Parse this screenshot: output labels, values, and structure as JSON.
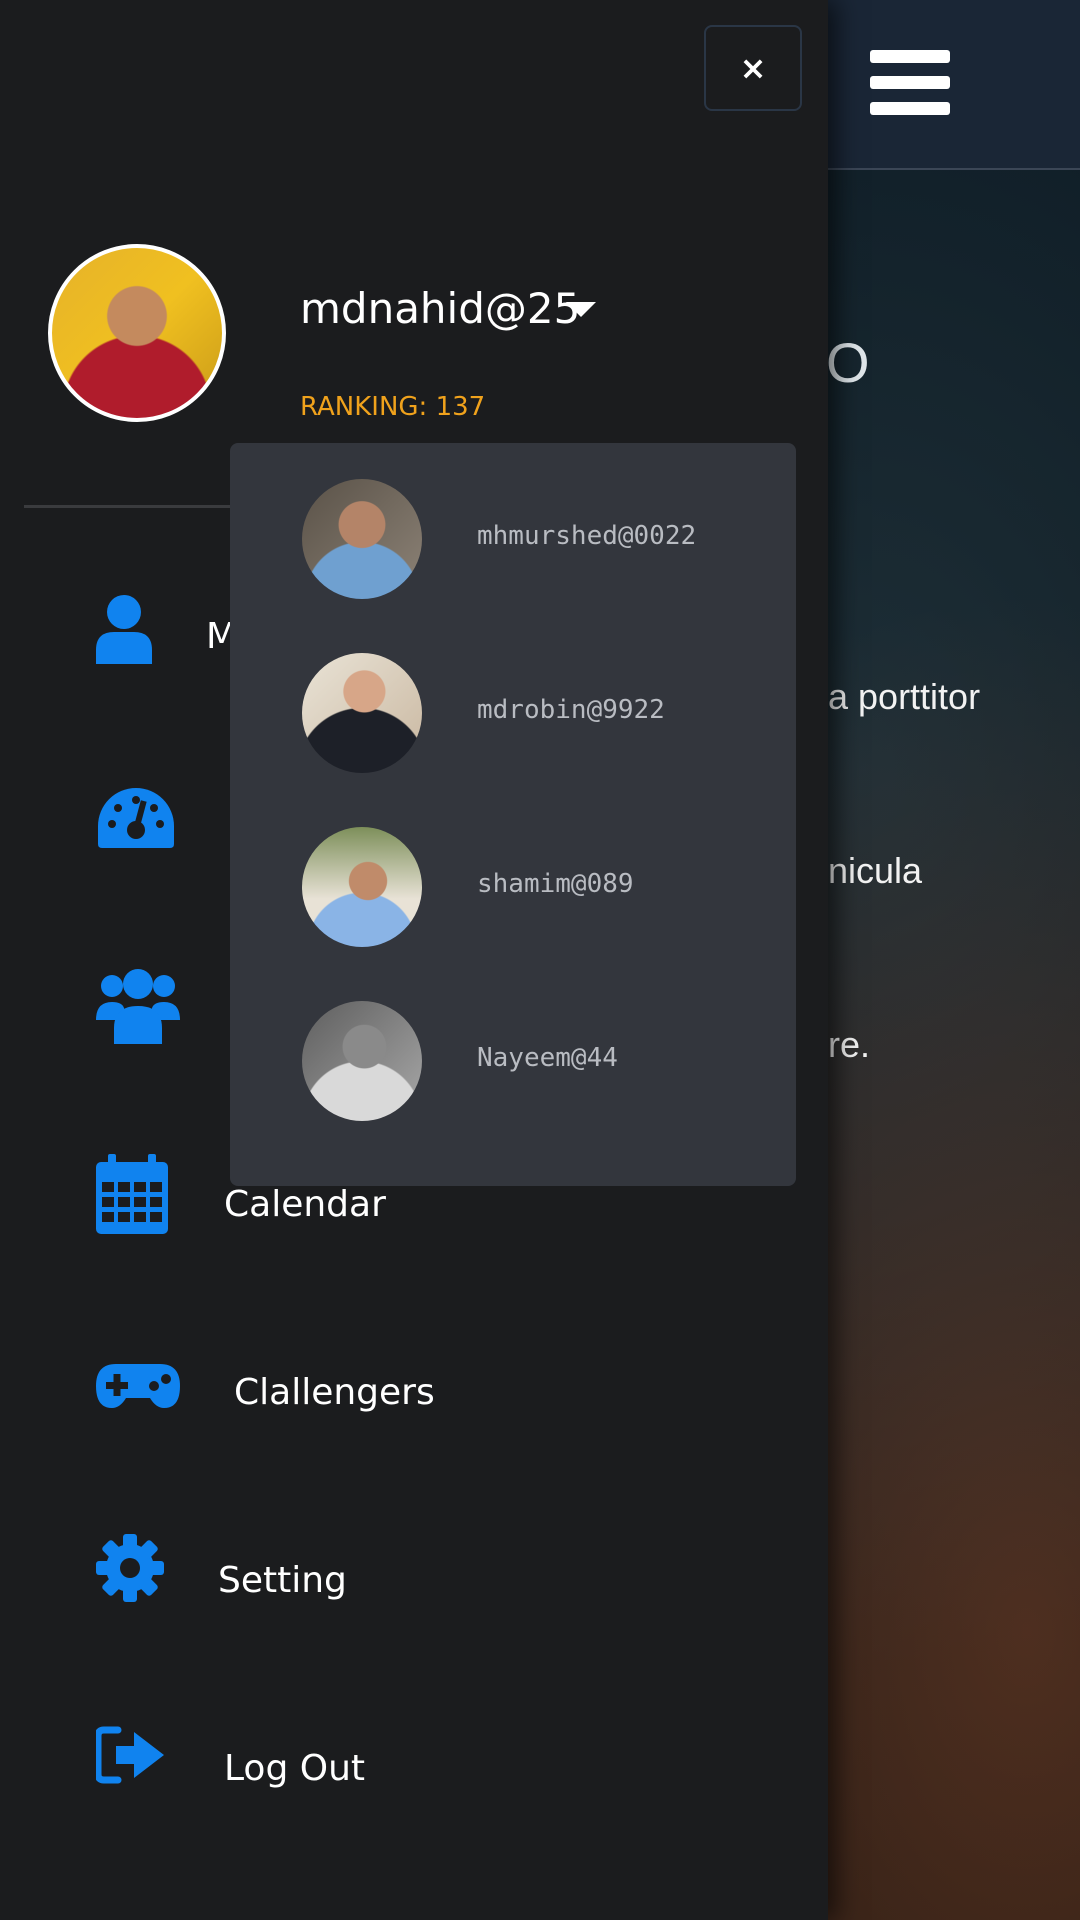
{
  "background": {
    "peek_char": "O",
    "lines": [
      "a porttitor",
      "nicula",
      "re."
    ]
  },
  "drawer": {
    "close_label": "×",
    "profile": {
      "username": "mdnahid@25",
      "ranking": "RANKING: 137"
    },
    "dropdown": {
      "items": [
        {
          "name": "mhmurshed@0022"
        },
        {
          "name": "mdrobin@9922"
        },
        {
          "name": "shamim@089"
        },
        {
          "name": "Nayeem@44"
        }
      ]
    },
    "menu": {
      "items": [
        {
          "label": "M",
          "icon": "user-icon"
        },
        {
          "label": "",
          "icon": "dashboard-icon"
        },
        {
          "label": "",
          "icon": "users-icon"
        },
        {
          "label": "Calendar",
          "icon": "calendar-icon"
        },
        {
          "label": "Clallengers",
          "icon": "gamepad-icon"
        },
        {
          "label": "Setting",
          "icon": "gear-icon"
        },
        {
          "label": "Log Out",
          "icon": "logout-icon"
        }
      ]
    }
  },
  "colors": {
    "accent": "#1083ef",
    "ranking": "#f0a21c",
    "drawer_bg": "#1b1c1e",
    "dropdown_bg": "#33363d"
  }
}
